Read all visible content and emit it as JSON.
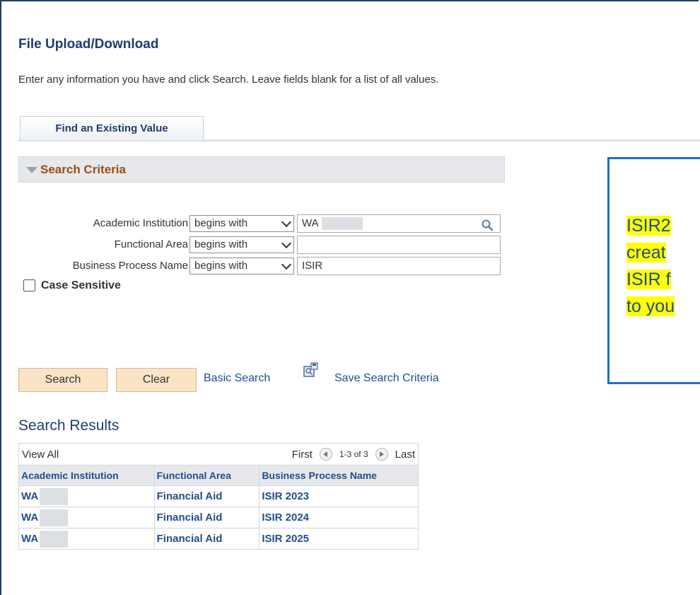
{
  "page": {
    "title": "File Upload/Download",
    "instructions": "Enter any information you have and click Search. Leave fields blank for a list of all values."
  },
  "tabs": [
    {
      "label": "Find an Existing Value"
    }
  ],
  "search_criteria": {
    "header": "Search Criteria",
    "fields": [
      {
        "label": "Academic Institution",
        "operator": "begins with",
        "value": "WA"
      },
      {
        "label": "Functional Area",
        "operator": "begins with",
        "value": ""
      },
      {
        "label": "Business Process Name",
        "operator": "begins with",
        "value": "ISIR"
      }
    ],
    "case_sensitive_label": "Case Sensitive"
  },
  "actions": {
    "search_label": "Search",
    "clear_label": "Clear",
    "basic_search_label": "Basic Search",
    "save_search_label": "Save Search Criteria"
  },
  "results": {
    "title": "Search Results",
    "view_all": "View All",
    "first": "First",
    "range": "1-3 of 3",
    "last": "Last",
    "columns": [
      "Academic Institution",
      "Functional Area",
      "Business Process Name"
    ],
    "rows": [
      [
        "WA",
        "Financial Aid",
        "ISIR 2023"
      ],
      [
        "WA",
        "Financial Aid",
        "ISIR 2024"
      ],
      [
        "WA",
        "Financial Aid",
        "ISIR 2025"
      ]
    ]
  },
  "callout": {
    "lines": [
      "ISIR2",
      "creat",
      "ISIR f",
      "to you"
    ]
  },
  "colors": {
    "title": "#1f3b6e",
    "section_header": "#9a4d12",
    "link": "#1f4e8c",
    "button_bg": "#fbe4c6",
    "callout_border": "#1f6fd0",
    "highlight": "#ffff00"
  }
}
